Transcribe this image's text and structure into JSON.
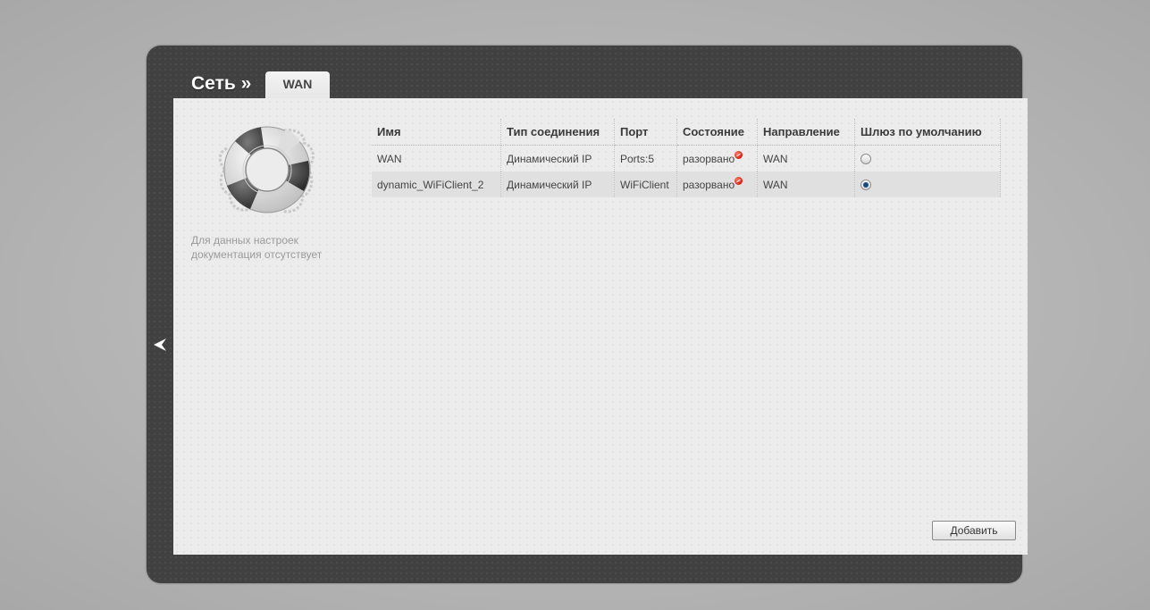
{
  "header": {
    "breadcrumb": "Сеть »",
    "tab_label": "WAN"
  },
  "help": {
    "icon": "lifebuoy-icon",
    "text": "Для данных настроек документация отсутствует"
  },
  "table": {
    "columns": [
      "Имя",
      "Тип соединения",
      "Порт",
      "Состояние",
      "Направление",
      "Шлюз по умолчанию"
    ],
    "rows": [
      {
        "name": "WAN",
        "type": "Динамический IP",
        "port": "Ports:5",
        "state": "разорвано",
        "direction": "WAN",
        "default_gateway": false
      },
      {
        "name": "dynamic_WiFiClient_2",
        "type": "Динамический IP",
        "port": "WiFiClient",
        "state": "разорвано",
        "direction": "WAN",
        "default_gateway": true
      }
    ]
  },
  "buttons": {
    "add_label": "Добавить"
  },
  "colors": {
    "status_disconnected": "#d51d0c",
    "frame": "#414141",
    "panel": "#ececec"
  }
}
